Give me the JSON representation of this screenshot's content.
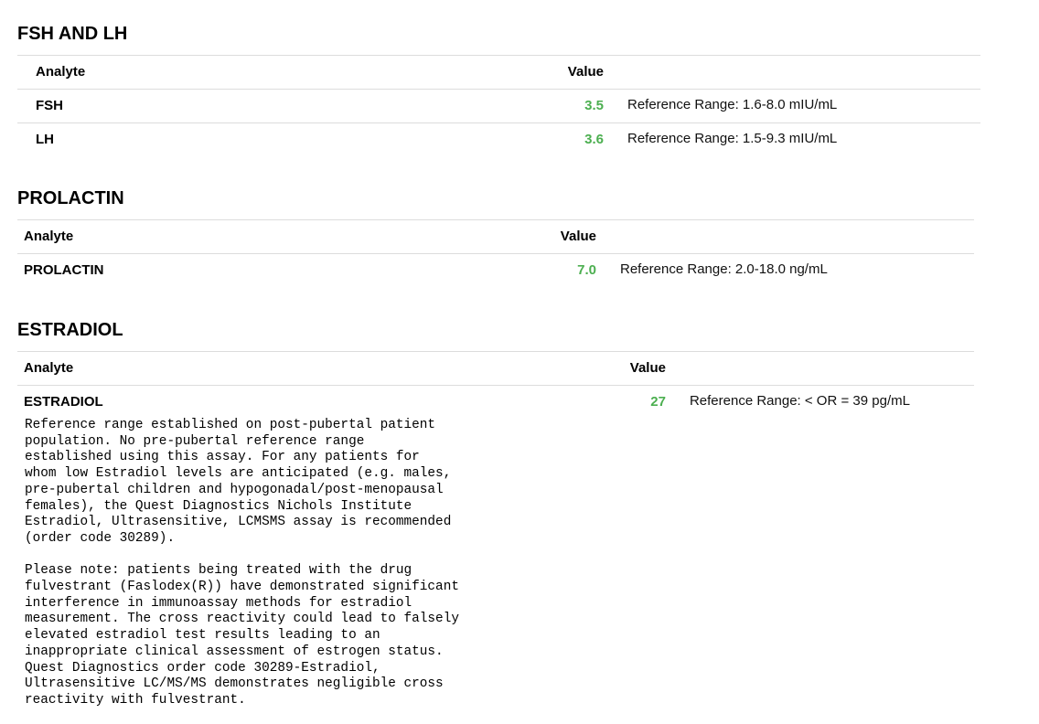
{
  "columns": {
    "analyte": "Analyte",
    "value": "Value"
  },
  "sections": [
    {
      "title": "FSH AND LH",
      "rows": [
        {
          "name": "FSH",
          "value": "3.5",
          "reference": "Reference Range: 1.6-8.0 mIU/mL"
        },
        {
          "name": "LH",
          "value": "3.6",
          "reference": "Reference Range: 1.5-9.3 mIU/mL"
        }
      ]
    },
    {
      "title": "PROLACTIN",
      "rows": [
        {
          "name": "PROLACTIN",
          "value": "7.0",
          "reference": "Reference Range: 2.0-18.0 ng/mL"
        }
      ]
    },
    {
      "title": "ESTRADIOL",
      "rows": [
        {
          "name": "ESTRADIOL",
          "value": "27",
          "reference": "Reference Range: < OR = 39 pg/mL",
          "comment": "Reference range established on post-pubertal patient\npopulation. No pre-pubertal reference range\nestablished using this assay. For any patients for\nwhom low Estradiol levels are anticipated (e.g. males,\npre-pubertal children and hypogonadal/post-menopausal\nfemales), the Quest Diagnostics Nichols Institute\nEstradiol, Ultrasensitive, LCMSMS assay is recommended\n(order code 30289).\n\nPlease note: patients being treated with the drug\nfulvestrant (Faslodex(R)) have demonstrated significant\ninterference in immunoassay methods for estradiol\nmeasurement. The cross reactivity could lead to falsely\nelevated estradiol test results leading to an\ninappropriate clinical assessment of estrogen status.\nQuest Diagnostics order code 30289-Estradiol,\nUltrasensitive LC/MS/MS demonstrates negligible cross\nreactivity with fulvestrant."
        }
      ]
    }
  ],
  "colors": {
    "value_normal": "#4caf50",
    "divider": "#dcdcdc"
  }
}
